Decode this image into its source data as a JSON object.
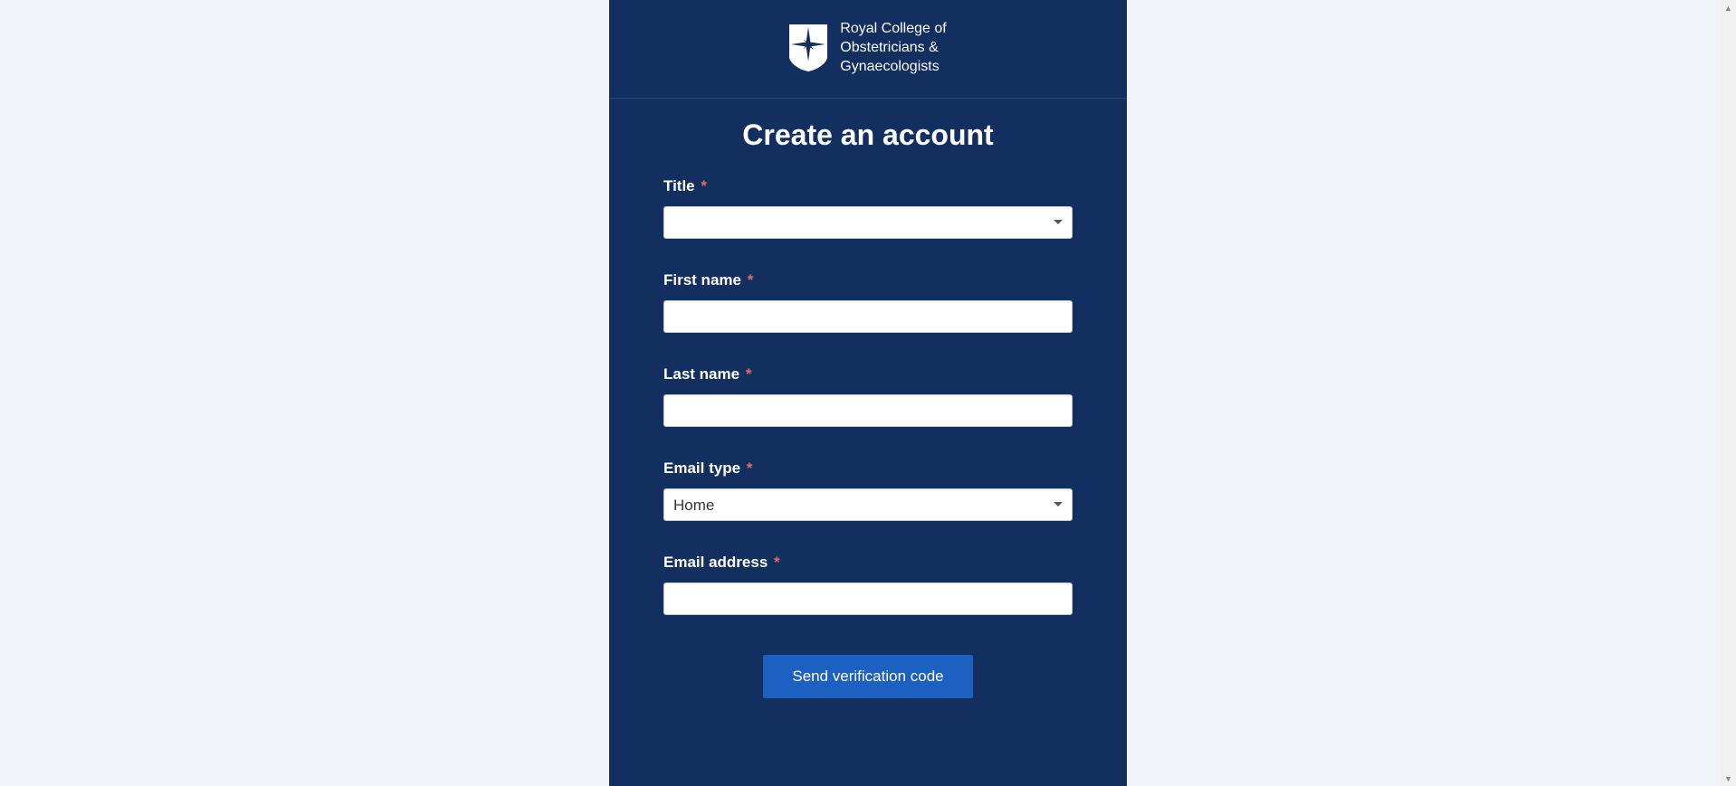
{
  "logo": {
    "line1": "Royal College of",
    "line2": "Obstetricians &",
    "line3": "Gynaecologists"
  },
  "page_title": "Create an account",
  "fields": {
    "title": {
      "label": "Title",
      "required": true,
      "value": ""
    },
    "first_name": {
      "label": "First name",
      "required": true,
      "value": ""
    },
    "last_name": {
      "label": "Last name",
      "required": true,
      "value": ""
    },
    "email_type": {
      "label": "Email type",
      "required": true,
      "value": "Home"
    },
    "email_address": {
      "label": "Email address",
      "required": true,
      "value": ""
    }
  },
  "buttons": {
    "send_verification": "Send verification code"
  },
  "required_marker": "*"
}
